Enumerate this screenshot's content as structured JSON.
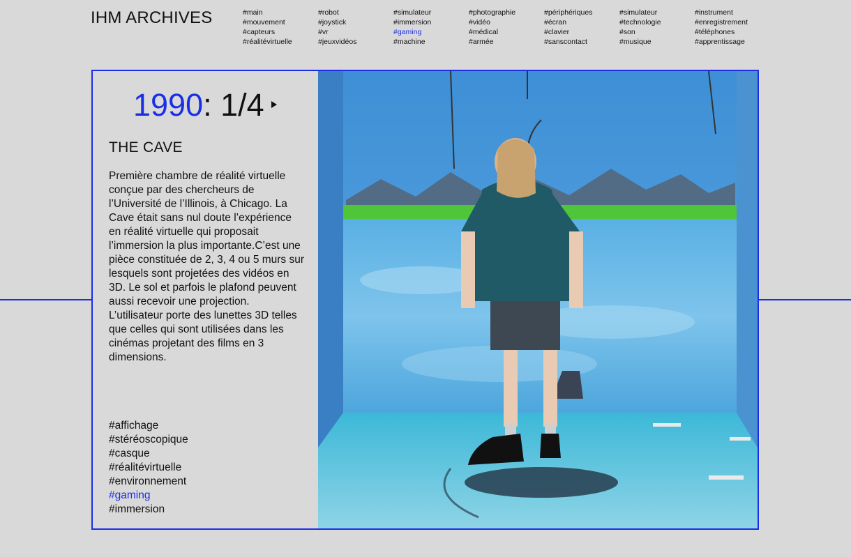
{
  "header": {
    "logo": "IHM ARCHIVES",
    "active_tag": "#gaming",
    "tag_columns": [
      [
        "#main",
        "#mouvement",
        "#capteurs",
        "#réalitévirtuelle"
      ],
      [
        "#robot",
        "#joystick",
        "#vr",
        "#jeuxvidéos"
      ],
      [
        "#simulateur",
        "#immersion",
        "#gaming",
        "#machine"
      ],
      [
        "#photographie",
        "#vidéo",
        "#médical",
        "#armée"
      ],
      [
        "#périphériques",
        "#écran",
        "#clavier",
        "#sanscontact"
      ],
      [
        "#simulateur",
        "#technologie",
        "#son",
        "#musique"
      ],
      [
        "#instrument",
        "#enregistrement",
        "#téléphones",
        "#apprentissage"
      ]
    ]
  },
  "entry": {
    "year": "1990",
    "counter": ": 1/4",
    "title": "THE CAVE",
    "description": "Première chambre de réalité virtuelle conçue par des chercheurs de l’Université de l’Illinois, à Chicago. La Cave était sans nul doute l’expérience en réalité virtuelle qui proposait l’immersion la plus importante.C’est une pièce constituée de 2, 3, 4 ou 5 murs sur lesquels sont projetées des vidéos en 3D. Le sol et parfois le plafond peuvent aussi recevoir une projection. L’utilisateur porte des lunettes 3D telles que celles qui sont utilisées dans les cinémas projetant des films en 3 dimensions.",
    "tags": [
      "#affichage",
      "#stéréoscopique",
      "#casque",
      "#réalitévirtuelle",
      "#environnement",
      "#gaming",
      "#immersion"
    ],
    "active_tag": "#gaming"
  },
  "colors": {
    "accent": "#1a2ee8",
    "background": "#d9d9d9",
    "text": "#111111"
  },
  "icons": {
    "next": "triangle-right"
  }
}
